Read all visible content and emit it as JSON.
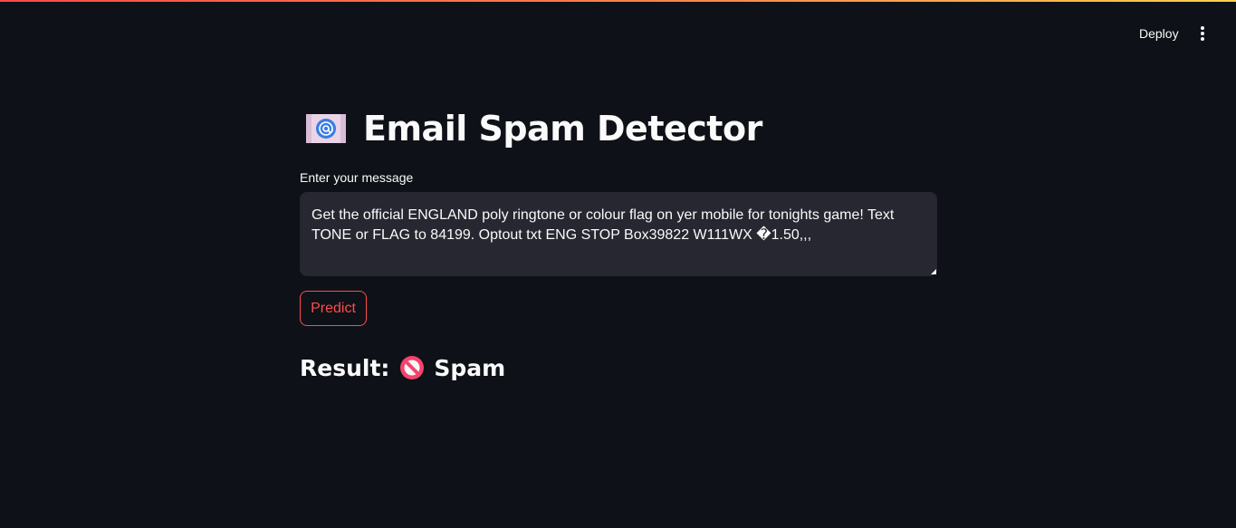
{
  "header": {
    "deploy_label": "Deploy",
    "menu_icon": "kebab-menu-icon"
  },
  "main": {
    "title": "Email Spam Detector",
    "title_icon": "envelope-icon",
    "input": {
      "label": "Enter your message",
      "value": "Get the official ENGLAND poly ringtone or colour flag on yer mobile for tonights game! Text TONE or FLAG to 84199. Optout txt ENG STOP Box39822 W111WX �1.50,,,"
    },
    "predict_label": "Predict",
    "result": {
      "prefix": "Result:",
      "icon": "no-entry-icon",
      "value": "Spam"
    }
  },
  "colors": {
    "background": "#0e1117",
    "input_background": "#262730",
    "accent": "#ff4b4b",
    "text": "#fafafa"
  }
}
